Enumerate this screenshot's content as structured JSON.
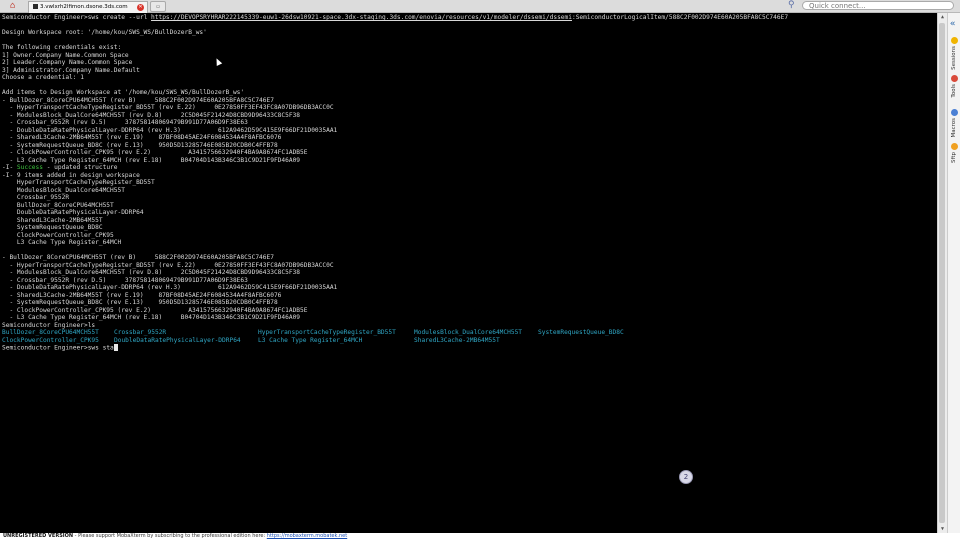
{
  "tabbar": {
    "tab_title": "3.vwlxrh2lfimon.dsone.3ds.com",
    "quick_connect_placeholder": "Quick connect..."
  },
  "sidebar": {
    "tabs": [
      "Sessions",
      "Tools",
      "Macros",
      "Sftp"
    ]
  },
  "terminal": {
    "prompt": "Semiconductor Engineer>",
    "cmd_create_pre": "sws create --url ",
    "cmd_create_url": "https://DEVOPSRYHRAR222145339-euw1-26dsw10921-space.3dx-staging.3ds.com/enovia/resources/v1/modeler/dssemi/dssemi",
    "cmd_create_post": ":SemiconductorLogicalItem/588C2F002D974E60A205BFA8C5C746E7",
    "workspace_root": "Design Workspace root: '/home/kou/SWS_WS/BullDozerB_ws'",
    "cred_header": "The following credentials exist:",
    "cred_1": "1] Owner.Company Name.Common Space",
    "cred_2": "2] Leader.Company Name.Common Space",
    "cred_3": "3] Administrator.Company Name.Default",
    "cred_choose": "Choose a credential: 1",
    "add_items": "Add items to Design Workspace at '/home/kou/SWS_WS/BullDozerB_ws'",
    "tree1": [
      "- BullDozer_8CoreCPU64MCH55T (rev B)     588C2F002D974E60A205BFA8C5C746E7",
      "  - HyperTransportCacheTypeRegister_BD55T (rev E.22)     0E27850FF3EF43FC8A07DB96DB3ACC0C",
      "  - ModulesBlock_DualCore64MCH55T (rev D.8)     2C5D045F21424D8CBD9D96433C8C5F38",
      "  - Crossbar_9552R (rev D.5)     378758148069479B991D77A06D9F38E63",
      "  - DoubleDataRatePhysicalLayer-DDRP64 (rev H.3)          612A9462D59C415E9F66DF21D0035AA1",
      "  - SharedL3Cache-2MB64M55T (rev E.19)    87BF08D45AE24F6084534A4F8AFBC6076",
      "  - SystemRequestQueue_BD8C (rev E.13)    950D5D13285746E085B20CDB0C4FFB78",
      "  - ClockPowerController_CPK95 (rev E.2)          A3415756632940F4BA9A8674FC1ADB5E",
      "  - L3 Cache Type Register_64MCH (rev E.18)     B04704D143B346C3B1C9D21F9FD46A09"
    ],
    "success_prefix": "-I- ",
    "success_word": "Success",
    "success_suffix": " - updated structure",
    "items_added": "-I- 9 items added in design workspace",
    "added": [
      "    HyperTransportCacheTypeRegister_BD55T",
      "    ModulesBlock_DualCore64MCH55T",
      "    Crossbar_9552R",
      "    BullDozer_8CoreCPU64MCH55T",
      "    DoubleDataRatePhysicalLayer-DDRP64",
      "    SharedL3Cache-2MB64M55T",
      "    SystemRequestQueue_BD8C",
      "    ClockPowerController_CPK95",
      "    L3 Cache Type Register_64MCH"
    ],
    "tree2": [
      "- BullDozer_8CoreCPU64MCH55T (rev B)     588C2F002D974E60A205BFA8C5C746E7",
      "  - HyperTransportCacheTypeRegister_BD55T (rev E.22)     0E27850FF3EF43FC8A07DB96DB3ACC0C",
      "  - ModulesBlock_DualCore64MCH55T (rev D.8)     2C5D045F21424D8CBD9D96433C8C5F38",
      "  - Crossbar_9552R (rev D.5)     378758148069479B991D77A06D9F38E63",
      "  - DoubleDataRatePhysicalLayer-DDRP64 (rev H.3)          612A9462D59C415E9F66DF21D0035AA1",
      "  - SharedL3Cache-2MB64M55T (rev E.19)    87BF08D45AE24F6084534A4F8AFBC6076",
      "  - SystemRequestQueue_BD8C (rev E.13)    950D5D13285746E085B20CDB0C4FFB78",
      "  - ClockPowerController_CPK95 (rev E.2)          A3415756632940F4BA9A8674FC1ADB5E",
      "  - L3 Cache Type Register_64MCH (rev E.18)     B04704D143B346C3B1C9D21F9FD46A09"
    ],
    "ls_cmd": "ls",
    "ls_row1": [
      "BullDozer_8CoreCPU64MCH55T",
      "Crossbar_9552R",
      "HyperTransportCacheTypeRegister_BD55T",
      "ModulesBlock_DualCore64MCH55T",
      "SystemRequestQueue_BD8C"
    ],
    "ls_row2": [
      "ClockPowerController_CPK95",
      "DoubleDataRatePhysicalLayer-DDRP64",
      "L3 Cache Type Register_64MCH",
      "SharedL3Cache-2MB64M55T"
    ],
    "current_cmd": "sws sta"
  },
  "notification_count": "2",
  "statusbar": {
    "unregistered": "UNREGISTERED VERSION",
    "message": " -  Please support MobaXterm by subscribing to the professional edition here: ",
    "link": "https://mobaxterm.mobatek.net"
  },
  "colors": {
    "terminal_bg": "#000000",
    "terminal_text": "#d8d8d8",
    "success_green": "#3ec23e",
    "ls_cyan": "#2fa6c4"
  }
}
